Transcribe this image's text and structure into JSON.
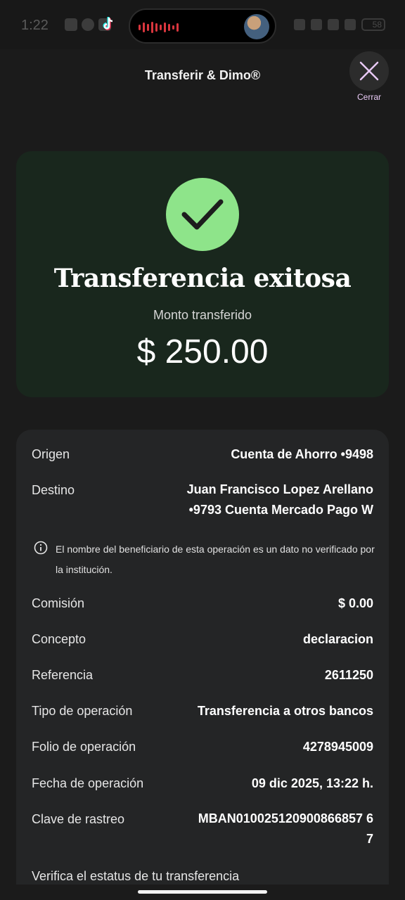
{
  "status_bar": {
    "time": "1:22",
    "battery": "58"
  },
  "header": {
    "title": "Transferir & Dimo®",
    "close_label": "Cerrar"
  },
  "success": {
    "title": "Transferencia exitosa",
    "amount_label": "Monto transferido",
    "amount": "$ 250.00",
    "check_color": "#8ee48a"
  },
  "details": {
    "origen": {
      "label": "Origen",
      "value": "Cuenta de Ahorro •9498"
    },
    "destino": {
      "label": "Destino",
      "value_line1": "Juan Francisco Lopez Arellano",
      "value_line2": "•9793 Cuenta Mercado Pago W"
    },
    "notice": "El nombre del beneficiario de esta operación es un dato no verificado por la institución.",
    "comision": {
      "label": "Comisión",
      "value": "$ 0.00"
    },
    "concepto": {
      "label": "Concepto",
      "value": "declaracion"
    },
    "referencia": {
      "label": "Referencia",
      "value": "2611250"
    },
    "tipo": {
      "label": "Tipo de operación",
      "value": "Transferencia a otros bancos"
    },
    "folio": {
      "label": "Folio de operación",
      "value": "4278945009"
    },
    "fecha": {
      "label": "Fecha de operación",
      "value": "09 dic 2025, 13:22 h."
    },
    "clave": {
      "label": "Clave de rastreo",
      "value_line1": "MBAN010025120900866857 6",
      "value_line2": "7"
    },
    "verify_link": "Verifica el estatus de tu transferencia"
  },
  "icons": {
    "close": "close-icon",
    "check": "check-icon",
    "info": "info-icon"
  },
  "colors": {
    "background": "#1b1b1b",
    "success_card": "#19271d",
    "details_card": "#242526",
    "close_label": "#e8c9f5"
  }
}
